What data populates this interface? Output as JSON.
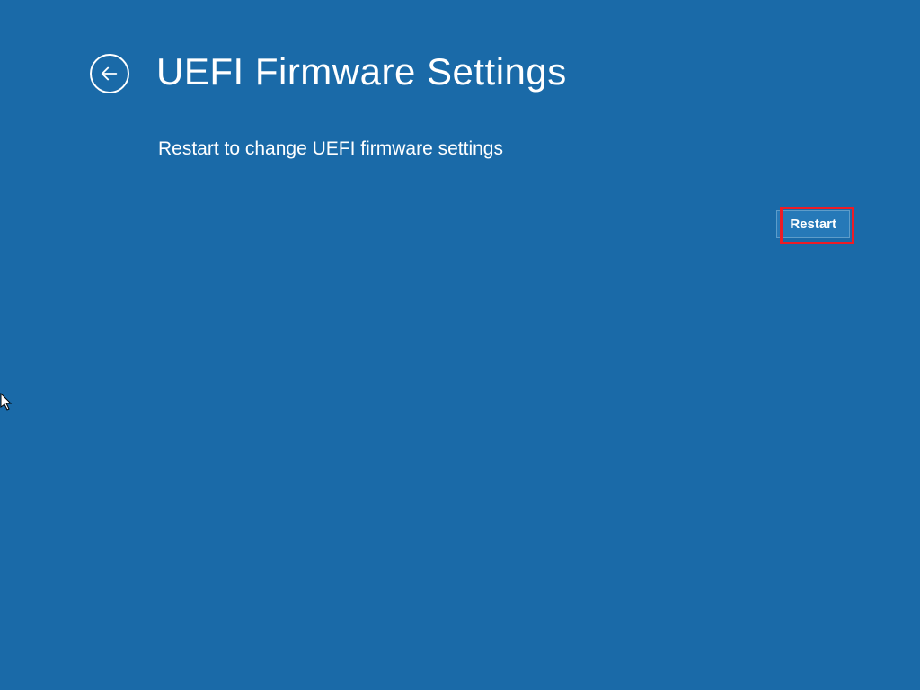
{
  "header": {
    "title": "UEFI Firmware Settings"
  },
  "body": {
    "description": "Restart to change UEFI firmware settings"
  },
  "buttons": {
    "restart_label": "Restart"
  }
}
